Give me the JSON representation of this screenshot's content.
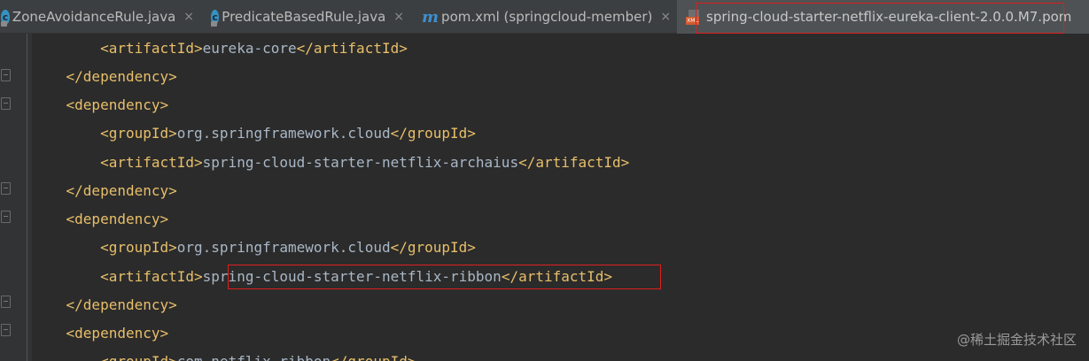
{
  "tabs": [
    {
      "label": "ZoneAvoidanceRule.java",
      "icon": "java-class-icon",
      "close": "×"
    },
    {
      "label": "PredicateBasedRule.java",
      "icon": "java-class-icon",
      "close": "×"
    },
    {
      "label": "pom.xml (springcloud-member)",
      "icon": "maven-icon",
      "icon_glyph": "m",
      "close": "×"
    },
    {
      "label": "spring-cloud-starter-netflix-eureka-client-2.0.0.M7.pom",
      "icon": "xml-file-icon",
      "icon_tag": "XML",
      "active": true
    }
  ],
  "code_lines": [
    {
      "indent": "        ",
      "open": "<artifactId>",
      "text": "eureka-core",
      "close": "</artifactId>"
    },
    {
      "indent": "    ",
      "open": "</dependency>",
      "text": "",
      "close": ""
    },
    {
      "indent": "    ",
      "open": "<dependency>",
      "text": "",
      "close": ""
    },
    {
      "indent": "        ",
      "open": "<groupId>",
      "text": "org.springframework.cloud",
      "close": "</groupId>"
    },
    {
      "indent": "        ",
      "open": "<artifactId>",
      "text": "spring-cloud-starter-netflix-archaius",
      "close": "</artifactId>"
    },
    {
      "indent": "    ",
      "open": "</dependency>",
      "text": "",
      "close": ""
    },
    {
      "indent": "    ",
      "open": "<dependency>",
      "text": "",
      "close": ""
    },
    {
      "indent": "        ",
      "open": "<groupId>",
      "text": "org.springframework.cloud",
      "close": "</groupId>"
    },
    {
      "indent": "        ",
      "open": "<artifactId>",
      "text": "spring-cloud-starter-netflix-ribbon",
      "close": "</artifactId>"
    },
    {
      "indent": "    ",
      "open": "</dependency>",
      "text": "",
      "close": ""
    },
    {
      "indent": "    ",
      "open": "<dependency>",
      "text": "",
      "close": ""
    },
    {
      "indent": "        ",
      "open": "<groupId>",
      "text": "com.netflix.ribbon",
      "close": "</groupId>"
    }
  ],
  "colors": {
    "background": "#2b2b2b",
    "tag": "#e8bf6a",
    "text": "#a9b7c6",
    "highlight_box": "#e01e1e"
  },
  "watermark": "@稀土掘金技术社区"
}
